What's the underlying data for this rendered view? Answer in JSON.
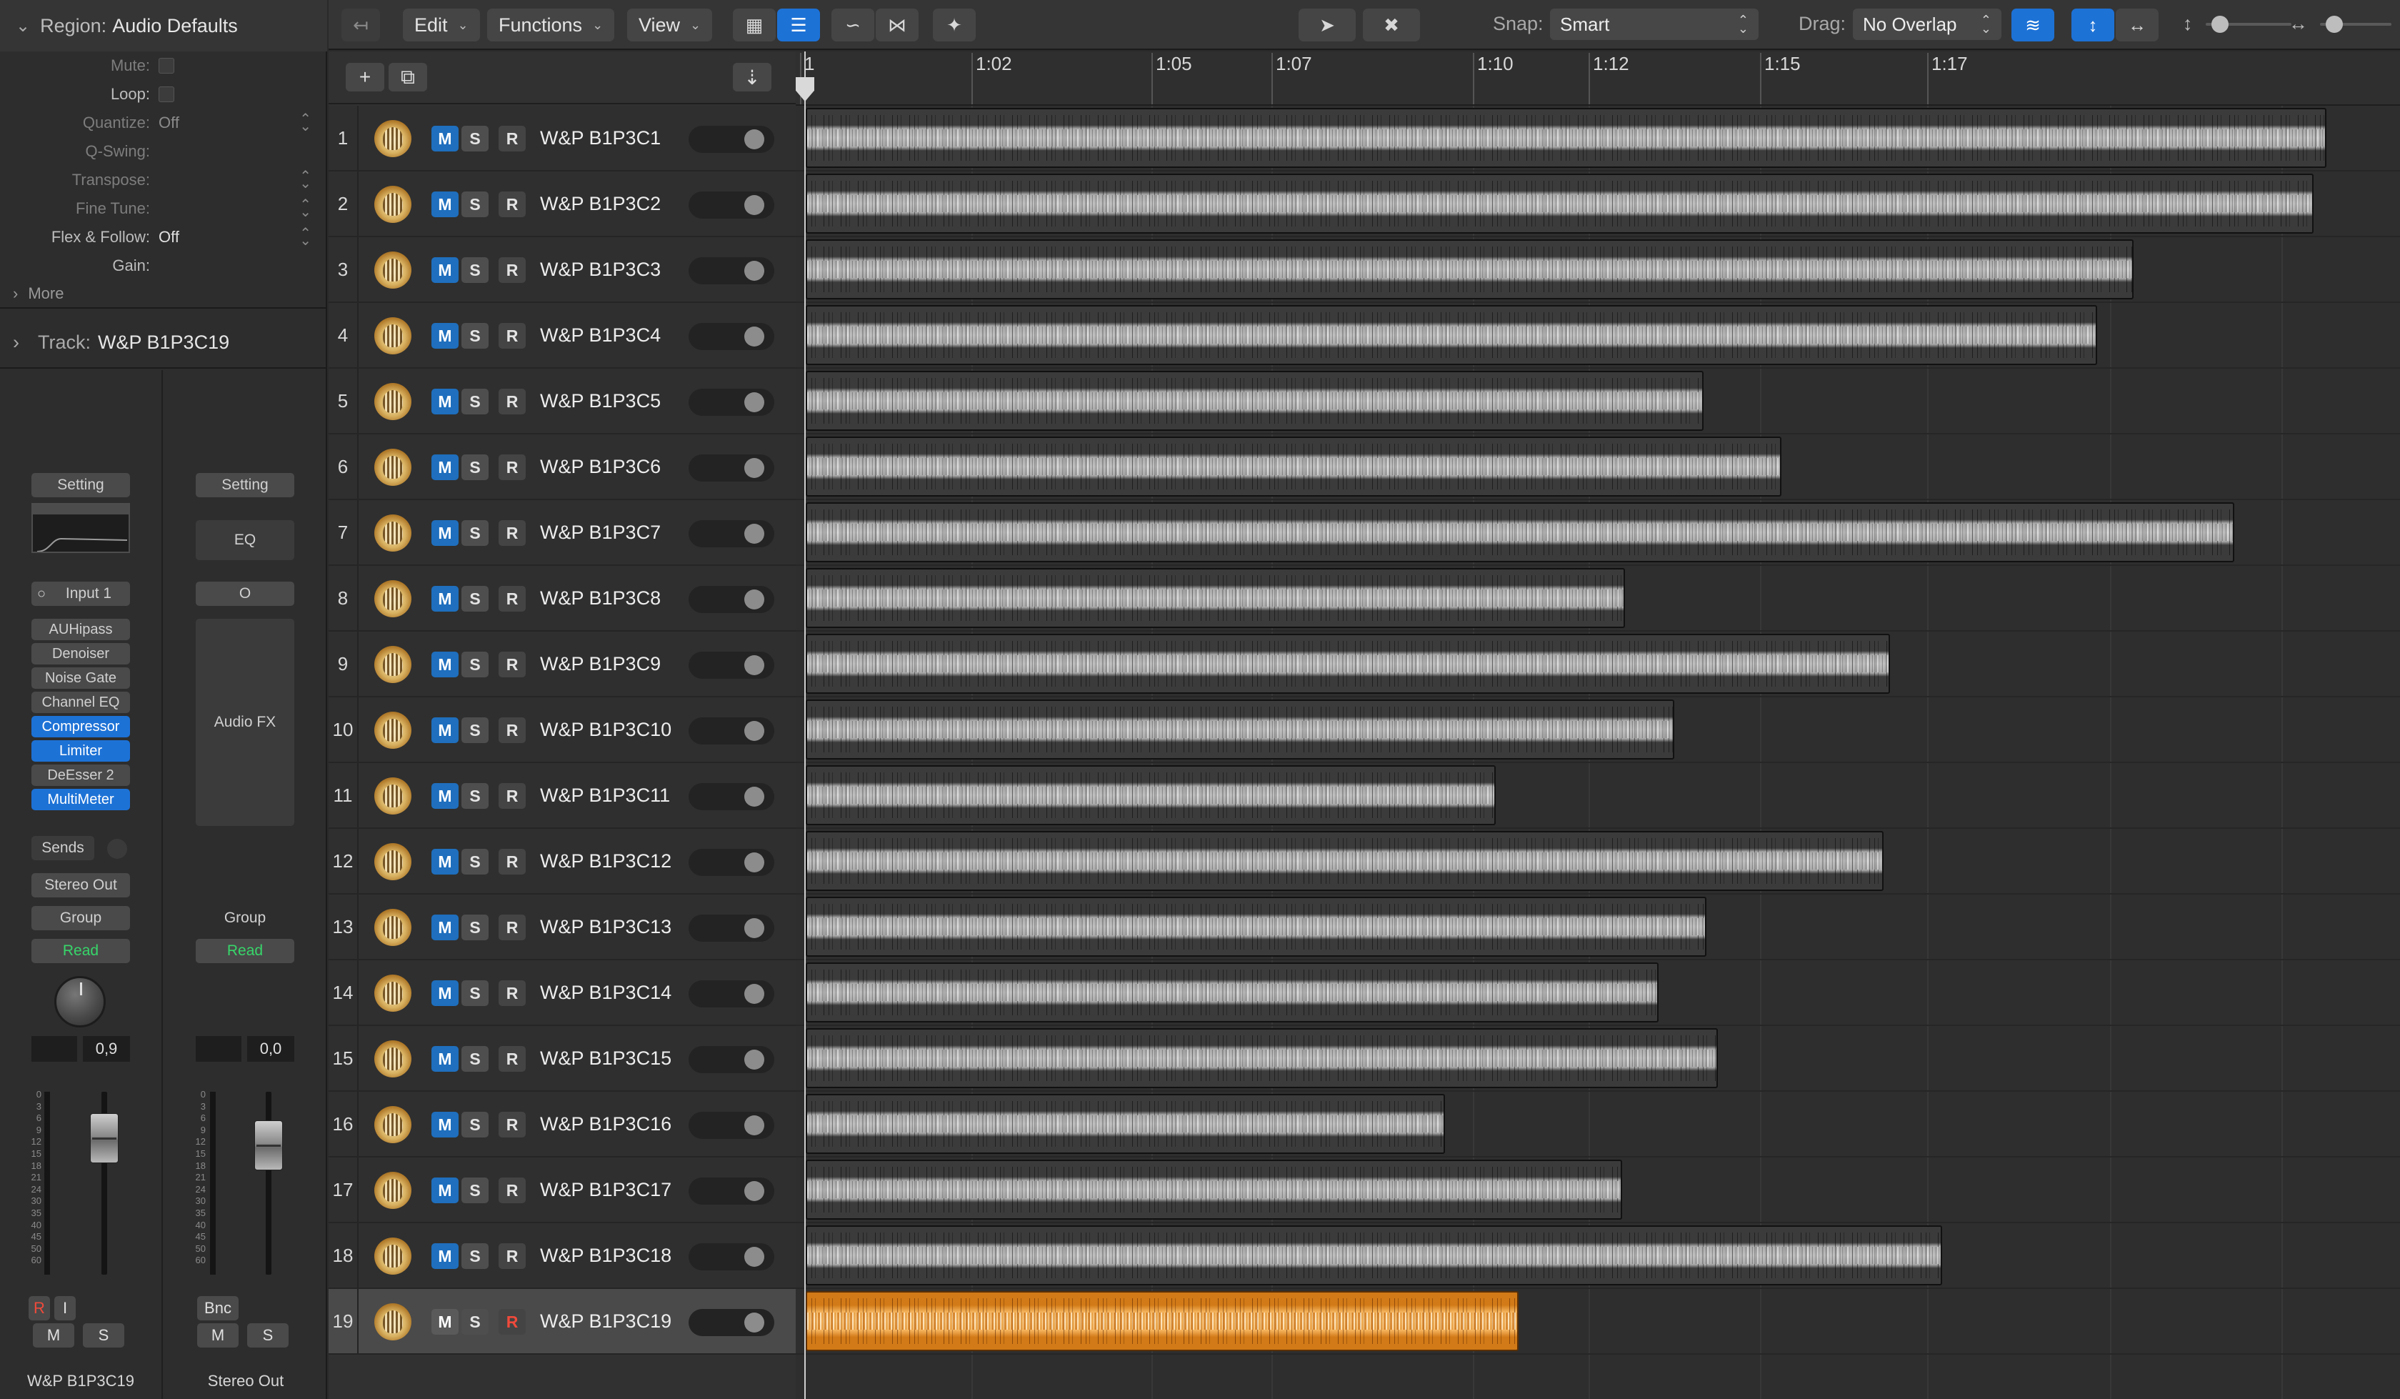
{
  "inspector": {
    "region_label": "Region:",
    "region_name": "Audio Defaults",
    "params": [
      {
        "label": "Mute:",
        "value": "",
        "type": "checkbox",
        "bright": false
      },
      {
        "label": "Loop:",
        "value": "",
        "type": "checkbox",
        "bright": true
      },
      {
        "label": "Quantize:",
        "value": "Off",
        "type": "select",
        "bright": false
      },
      {
        "label": "Q-Swing:",
        "value": "",
        "type": "none",
        "bright": false
      },
      {
        "label": "Transpose:",
        "value": "",
        "type": "stepper",
        "bright": false
      },
      {
        "label": "Fine Tune:",
        "value": "",
        "type": "stepper",
        "bright": false
      },
      {
        "label": "Flex & Follow:",
        "value": "Off",
        "type": "select",
        "bright": true
      },
      {
        "label": "Gain:",
        "value": "",
        "type": "none",
        "bright": true
      }
    ],
    "more_label": "More",
    "track_label": "Track:",
    "track_name": "W&P B1P3C19"
  },
  "strip1": {
    "setting": "Setting",
    "input": "Input 1",
    "plugins": [
      {
        "name": "AUHipass",
        "active": false
      },
      {
        "name": "Denoiser",
        "active": false
      },
      {
        "name": "Noise Gate",
        "active": false
      },
      {
        "name": "Channel EQ",
        "active": false
      },
      {
        "name": "Compressor",
        "active": true
      },
      {
        "name": "Limiter",
        "active": true
      },
      {
        "name": "DeEsser 2",
        "active": false
      },
      {
        "name": "MultiMeter",
        "active": true
      }
    ],
    "sends": "Sends",
    "output": "Stereo Out",
    "group": "Group",
    "automation": "Read",
    "pan_value": "0,9",
    "rec_label": "R",
    "input_mon_label": "I",
    "mute": "M",
    "solo": "S",
    "name": "W&P B1P3C19"
  },
  "strip2": {
    "setting": "Setting",
    "eq": "EQ",
    "link": "O",
    "audio_fx": "Audio FX",
    "group": "Group",
    "automation": "Read",
    "value": "0,0",
    "bounce": "Bnc",
    "mute": "M",
    "solo": "S",
    "name": "Stereo Out"
  },
  "meter_scale": [
    "0",
    "3",
    "6",
    "9",
    "12",
    "15",
    "18",
    "21",
    "24",
    "30",
    "35",
    "40",
    "45",
    "50",
    "60"
  ],
  "toolbar": {
    "edit": "Edit",
    "functions": "Functions",
    "view": "View",
    "snap_label": "Snap:",
    "snap_value": "Smart",
    "drag_label": "Drag:",
    "drag_value": "No Overlap"
  },
  "ruler": {
    "ticks": [
      "1",
      "1:02",
      "1:05",
      "1:07",
      "1:10",
      "1:12",
      "1:15",
      "1:17"
    ]
  },
  "tracks": [
    {
      "num": "1",
      "name": "W&P B1P3C1",
      "length": 0.954
    },
    {
      "num": "2",
      "name": "W&P B1P3C2",
      "length": 0.946
    },
    {
      "num": "3",
      "name": "W&P B1P3C3",
      "length": 0.833
    },
    {
      "num": "4",
      "name": "W&P B1P3C4",
      "length": 0.81
    },
    {
      "num": "5",
      "name": "W&P B1P3C5",
      "length": 0.563
    },
    {
      "num": "6",
      "name": "W&P B1P3C6",
      "length": 0.612
    },
    {
      "num": "7",
      "name": "W&P B1P3C7",
      "length": 0.896
    },
    {
      "num": "8",
      "name": "W&P B1P3C8",
      "length": 0.514
    },
    {
      "num": "9",
      "name": "W&P B1P3C9",
      "length": 0.68
    },
    {
      "num": "10",
      "name": "W&P B1P3C10",
      "length": 0.545
    },
    {
      "num": "11",
      "name": "W&P B1P3C11",
      "length": 0.433
    },
    {
      "num": "12",
      "name": "W&P B1P3C12",
      "length": 0.676
    },
    {
      "num": "13",
      "name": "W&P B1P3C13",
      "length": 0.565
    },
    {
      "num": "14",
      "name": "W&P B1P3C14",
      "length": 0.535
    },
    {
      "num": "15",
      "name": "W&P B1P3C15",
      "length": 0.572
    },
    {
      "num": "16",
      "name": "W&P B1P3C16",
      "length": 0.401
    },
    {
      "num": "17",
      "name": "W&P B1P3C17",
      "length": 0.512
    },
    {
      "num": "18",
      "name": "W&P B1P3C18",
      "length": 0.713
    },
    {
      "num": "19",
      "name": "W&P B1P3C19",
      "length": 0.447
    }
  ],
  "selected_track": "19",
  "track_buttons": {
    "mute": "M",
    "solo": "S",
    "record": "R"
  },
  "colors": {
    "accent": "#1d72d6",
    "region_selected": "#d27a17",
    "region": "#3b3b3b",
    "read_green": "#37d66a"
  }
}
